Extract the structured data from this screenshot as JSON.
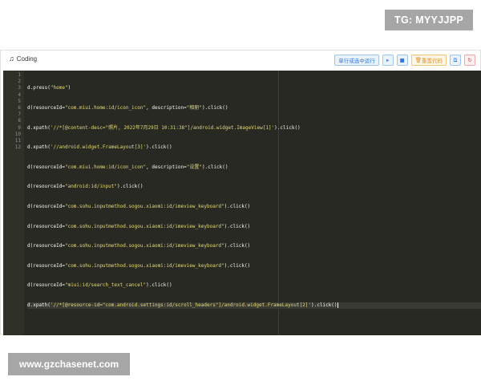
{
  "watermarks": {
    "top": "TG: MYYJJPP",
    "bottom": "www.gzchasenet.com"
  },
  "header": {
    "icon": "music-note-icon",
    "title": "Coding"
  },
  "toolbar": {
    "run_line_label": "单行或选中运行",
    "play_icon": "play-icon",
    "stop_icon": "stop-icon",
    "reset_label": "重置代码",
    "copy_icon": "copy-icon",
    "refresh_icon": "refresh-icon"
  },
  "editor": {
    "line_numbers": [
      "1",
      "2",
      "3",
      "4",
      "5",
      "6",
      "7",
      "8",
      "9",
      "10",
      "11",
      "12"
    ],
    "active_line": 12,
    "lines": [
      "d.press(\"home\")",
      "d(resourceId=\"com.miui.home:id/icon_icon\", description=\"相册\").click()",
      "d.xpath('//*[@content-desc=\"照片, 2022年7月29日 10:31:38\"]/android.widget.ImageView[1]').click()",
      "d.xpath('//android.widget.FrameLayout[3]').click()",
      "d(resourceId=\"com.miui.home:id/icon_icon\", description=\"设置\").click()",
      "d(resourceId=\"android:id/input\").click()",
      "d(resourceId=\"com.sohu.inputmethod.sogou.xiaomi:id/imeview_keyboard\").click()",
      "d(resourceId=\"com.sohu.inputmethod.sogou.xiaomi:id/imeview_keyboard\").click()",
      "d(resourceId=\"com.sohu.inputmethod.sogou.xiaomi:id/imeview_keyboard\").click()",
      "d(resourceId=\"com.sohu.inputmethod.sogou.xiaomi:id/imeview_keyboard\").click()",
      "d(resourceId=\"miui:id/search_text_cancel\").click()",
      "d.xpath('//*[@resource-id=\"com.android.settings:id/scroll_headers\"]/android.widget.FrameLayout[2]').click()"
    ]
  },
  "colors": {
    "editor_bg": "#282923",
    "gutter_bg": "#2f3129",
    "code_text": "#f8f8f2",
    "string": "#e6db74",
    "accent_blue": "#2c7be5",
    "accent_orange": "#e0962a",
    "accent_red": "#e04848"
  }
}
